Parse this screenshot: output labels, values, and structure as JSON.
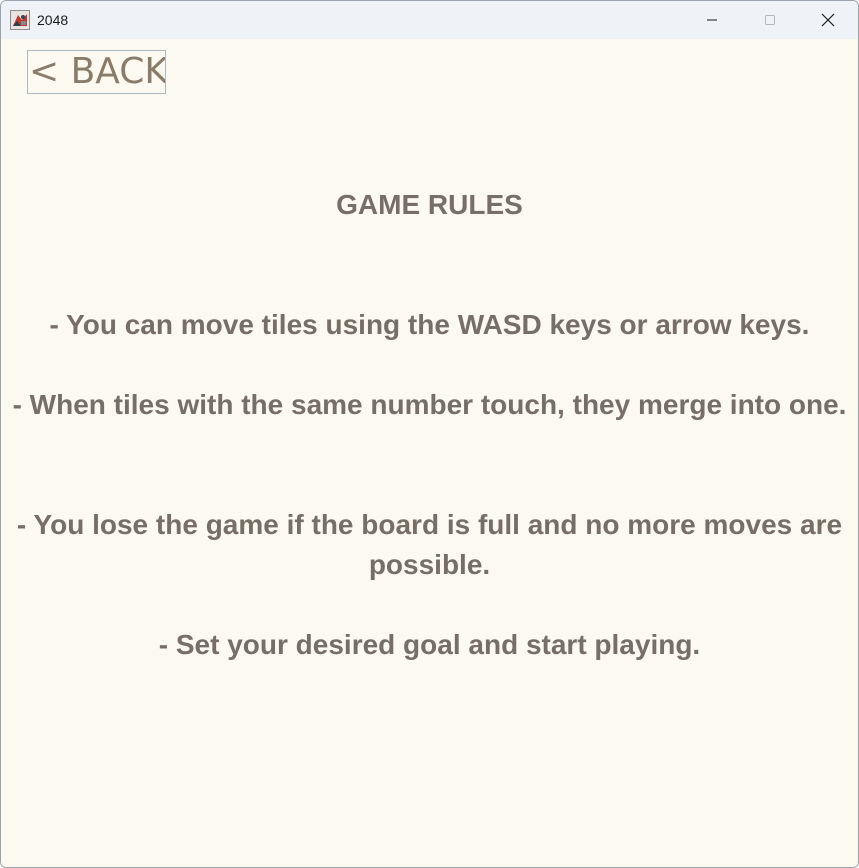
{
  "window": {
    "title": "2048",
    "icon": "java-app-icon",
    "controls": {
      "minimize": "minimize-icon",
      "maximize": "maximize-icon",
      "close": "close-icon"
    }
  },
  "back_button": {
    "label": "< BACK"
  },
  "rules": {
    "title": "GAME RULES",
    "items": [
      "- You can move tiles using the WASD keys or arrow keys.",
      "- When tiles with the same number touch, they merge into one.",
      "- You lose the game if the board is full and no more moves are possible.",
      "- Set your desired goal and start playing."
    ]
  },
  "colors": {
    "background": "#fcf9f1",
    "text": "#776e65",
    "back_text": "#8a7c69",
    "titlebar": "#eff3f8"
  }
}
